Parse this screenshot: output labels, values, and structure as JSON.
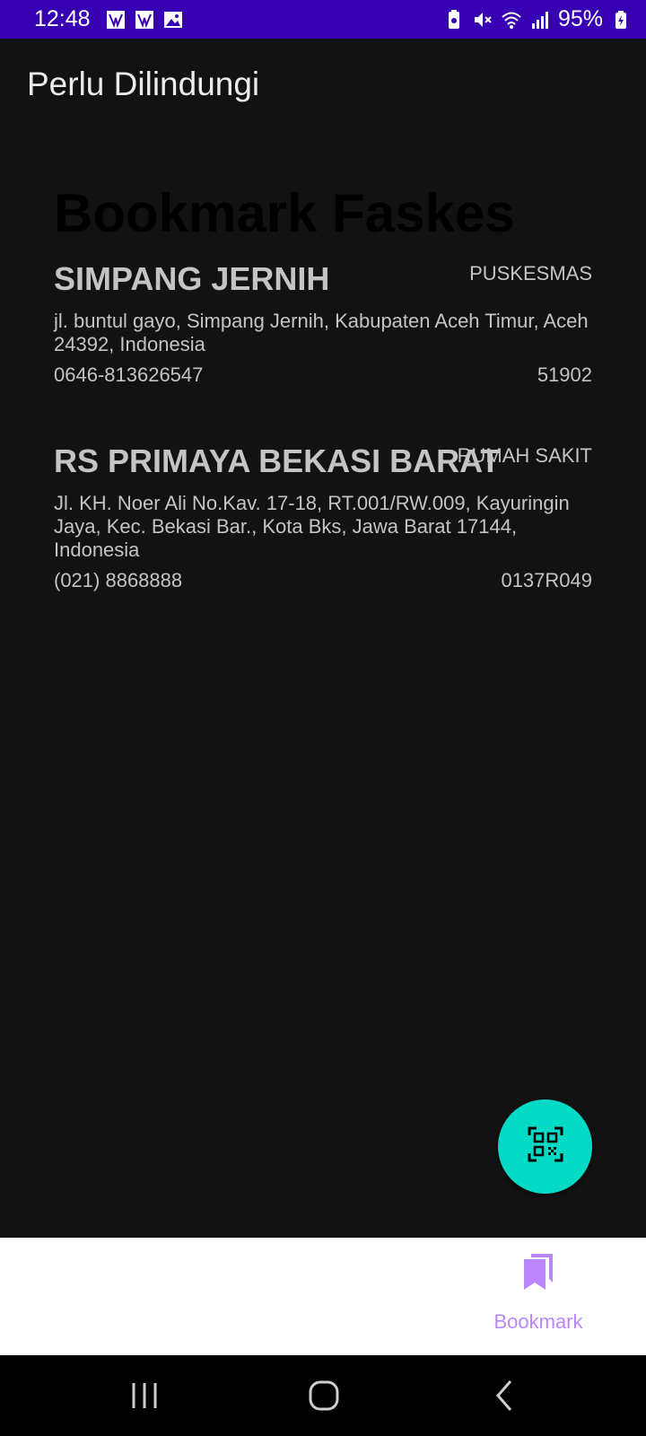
{
  "status_bar": {
    "time": "12:48",
    "battery": "95%"
  },
  "app_bar": {
    "title": "Perlu Dilindungi"
  },
  "page": {
    "heading": "Bookmark Faskes"
  },
  "bookmarks": [
    {
      "name": "SIMPANG JERNIH",
      "type": "PUSKESMAS",
      "address": "jl. buntul gayo, Simpang Jernih, Kabupaten Aceh Timur, Aceh 24392, Indonesia",
      "phone": "0646-813626547",
      "code": "51902"
    },
    {
      "name": "RS PRIMAYA BEKASI BARAT",
      "type": "RUMAH SAKIT",
      "address": "Jl. KH. Noer Ali No.Kav. 17-18, RT.001/RW.009, Kayuringin Jaya, Kec. Bekasi Bar., Kota Bks, Jawa Barat 17144, Indonesia",
      "phone": "(021) 8868888",
      "code": "0137R049"
    }
  ],
  "fab": {
    "icon": "qr-scan-icon"
  },
  "bottom_nav": {
    "items": [
      {
        "label": "Bookmark",
        "icon": "bookmark-icon"
      }
    ]
  },
  "colors": {
    "status_bar": "#3700b3",
    "background": "#121212",
    "fab": "#03dac5",
    "nav_active": "#bb86fc"
  }
}
